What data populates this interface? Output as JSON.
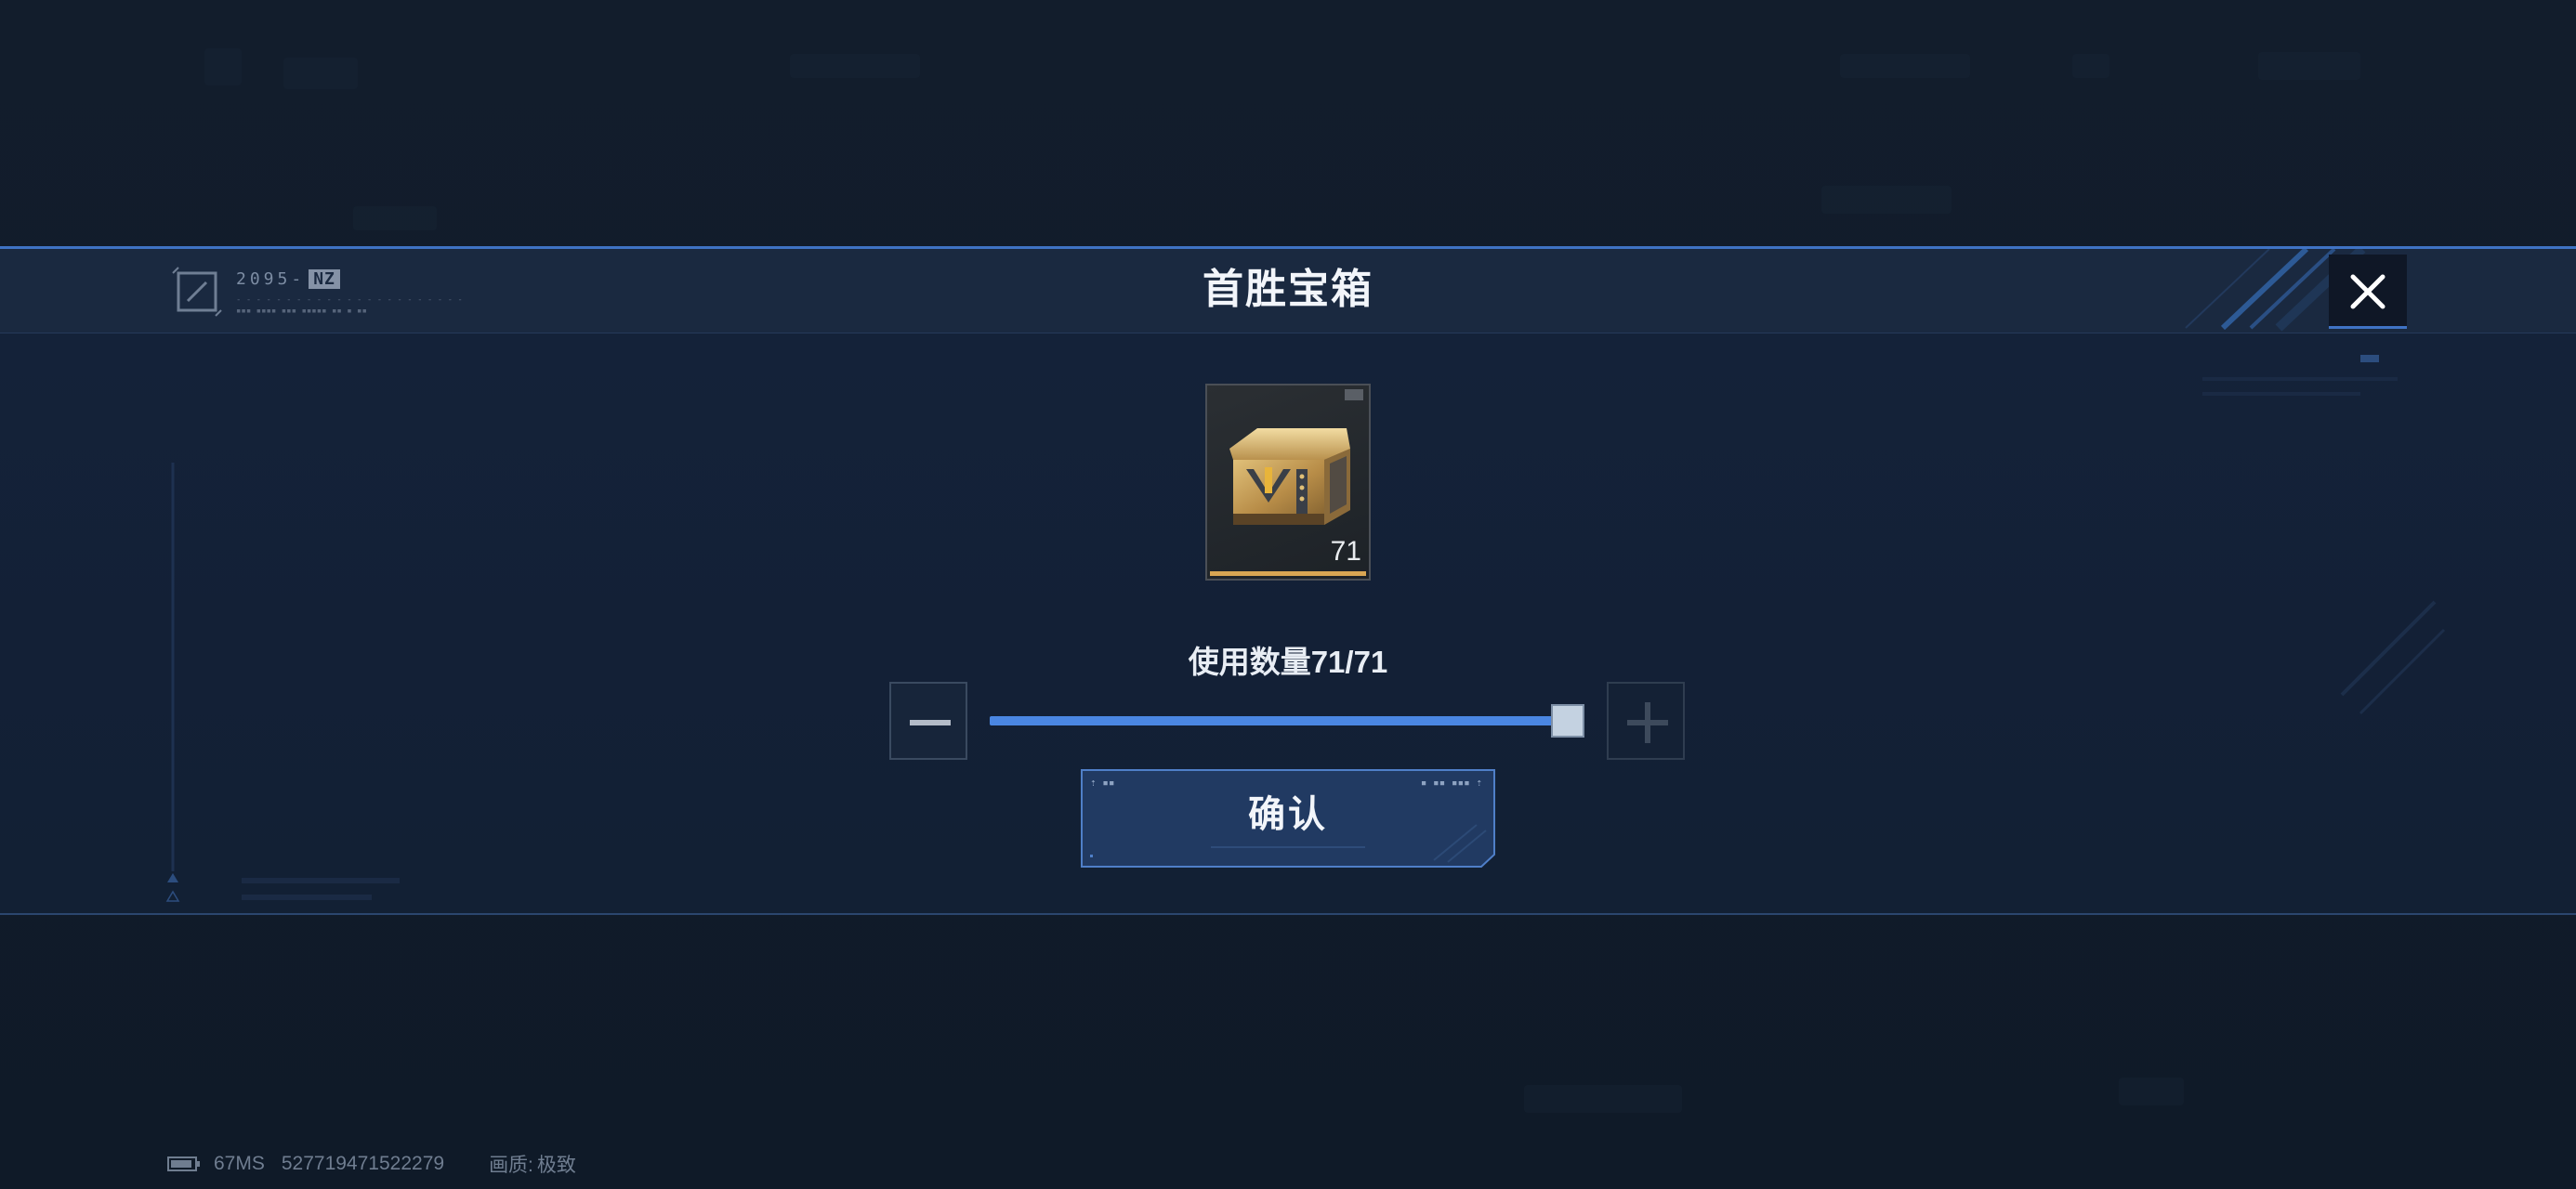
{
  "modal": {
    "title": "首胜宝箱",
    "header_code": "2095-",
    "header_code_tag": "NZ",
    "close_icon": "close-icon"
  },
  "item": {
    "icon": "treasure-chest-icon",
    "count": "71",
    "rarity_color": "#d9a653"
  },
  "quantity": {
    "label": "使用数量71/71",
    "current": 71,
    "max": 71,
    "minus_icon": "minus-icon",
    "plus_icon": "plus-icon"
  },
  "confirm": {
    "label": "确认"
  },
  "status_bar": {
    "battery_icon": "battery-icon",
    "latency": "67MS",
    "id": "527719471522279",
    "quality_label": "画质:",
    "quality_value": "极致"
  },
  "colors": {
    "accent": "#3f73c4",
    "slider_fill": "#4a86e2",
    "background": "#101a27"
  }
}
